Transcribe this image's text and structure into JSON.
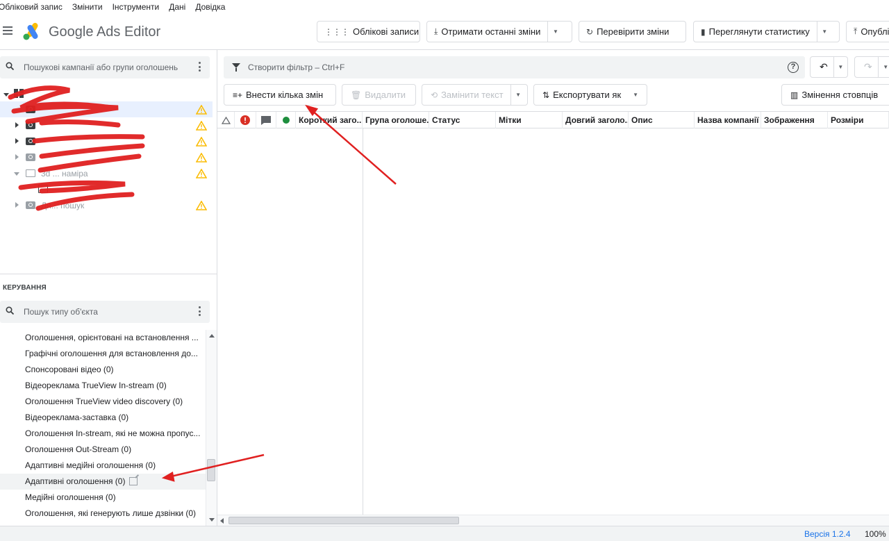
{
  "menu": [
    "Обліковий запис",
    "Змінити",
    "Інструменти",
    "Дані",
    "Довідка"
  ],
  "app": {
    "title": "Google Ads Editor"
  },
  "toolbar": {
    "accounts": "Облікові записи",
    "get_changes": "Отримати останні зміни",
    "check_changes": "Перевірити зміни",
    "view_stats": "Переглянути статистику",
    "publish": "Опублі"
  },
  "tree": {
    "search_placeholder": "Пошукові кампанії або групи оголошень",
    "items": [
      {
        "label": ""
      },
      {
        "label": ""
      },
      {
        "label": ""
      },
      {
        "label": ""
      },
      {
        "label": "3d ... наміра"
      },
      {
        "label": ""
      },
      {
        "label": "Ди... пошук"
      }
    ]
  },
  "manage": {
    "title": "КЕРУВАННЯ",
    "search_placeholder": "Пошук типу об'єкта",
    "types": [
      "Оголошення, орієнтовані на встановлення ...",
      "Графічні оголошення для встановлення до...",
      "Спонсоровані відео (0)",
      "Відеореклама TrueView In-stream (0)",
      "Оголошення TrueView video discovery (0)",
      "Відеореклама-заставка (0)",
      "Оголошення In-stream, які не можна пропус...",
      "Оголошення Out-Stream (0)",
      "Адаптивні медійні оголошення (0)",
      "Адаптивні оголошення (0)",
      "Медійні оголошення (0)",
      "Оголошення, які генерують лише дзвінки (0)"
    ]
  },
  "filter": {
    "placeholder": "Створити фільтр – Ctrl+F",
    "help": "?"
  },
  "actions": {
    "make_changes": "Внести кілька змін",
    "delete": "Видалити",
    "replace_text": "Замінити текст",
    "export": "Експортувати як",
    "columns": "Змінення стовпців"
  },
  "grid": {
    "columns": [
      "Короткий заго...",
      "Група оголоше...",
      "Статус",
      "Мітки",
      "Довгий заголо...",
      "Опис",
      "Назва компанії",
      "Зображення",
      "Розміри"
    ]
  },
  "status": {
    "version": "Версія 1.2.4",
    "zoom": "100%"
  },
  "colors": {
    "accent": "#1a73e8",
    "warning": "#fbbc04",
    "error": "#d93025",
    "ok": "#1e8e3e",
    "annotation": "#e02020"
  }
}
